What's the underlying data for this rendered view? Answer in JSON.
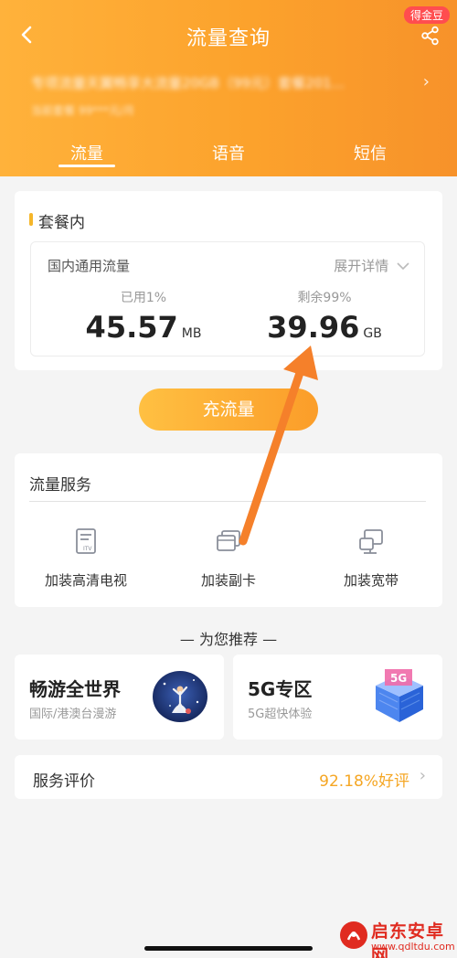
{
  "header": {
    "badge": "得金豆",
    "title": "流量查询",
    "plan_name": "专项流量天翼畅享大流量20GB（99元）套餐201...",
    "plan_sub": "当前套餐 99***元/月",
    "plan_arrow": "›"
  },
  "tabs": [
    {
      "label": "流量",
      "active": true
    },
    {
      "label": "语音",
      "active": false
    },
    {
      "label": "短信",
      "active": false
    }
  ],
  "package": {
    "section_title": "套餐内",
    "item_title": "国内通用流量",
    "expand_label": "展开详情",
    "used_label": "已用1%",
    "used_value": "45.57",
    "used_unit": "MB",
    "remaining_label": "剩余99%",
    "remaining_value": "39.96",
    "remaining_unit": "GB"
  },
  "recharge_button": "充流量",
  "services": {
    "title": "流量服务",
    "items": [
      {
        "label": "加装高清电视",
        "icon": "itv-icon"
      },
      {
        "label": "加装副卡",
        "icon": "sim-card-icon"
      },
      {
        "label": "加装宽带",
        "icon": "broadband-icon"
      }
    ]
  },
  "recommend": {
    "title": "— 为您推荐 —",
    "cards": [
      {
        "name": "畅游全世界",
        "desc": "国际/港澳台漫游",
        "icon": "travel-illustration"
      },
      {
        "name": "5G专区",
        "desc": "5G超快体验",
        "icon": "5g-cube-illustration"
      }
    ]
  },
  "rating": {
    "label": "服务评价",
    "value": "92.18%好评"
  },
  "watermark": {
    "text": "启东安卓网",
    "url": "www.qdltdu.com"
  },
  "colors": {
    "header_gradient_start": "#ffb23b",
    "header_gradient_end": "#f7922a",
    "accent": "#f5a623",
    "annotation_arrow": "#f5802a"
  }
}
